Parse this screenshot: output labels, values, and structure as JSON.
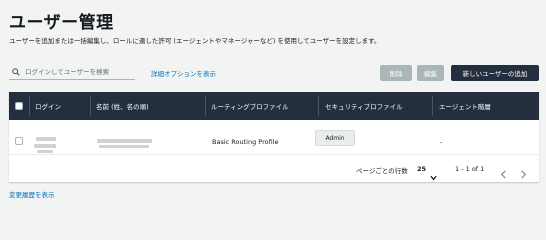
{
  "page": {
    "title": "ユーザー管理",
    "description": "ユーザーを追加または一括編集し、ロールに適した許可 (エージェントやマネージャーなど) を使用してユーザーを設定します。"
  },
  "toolbar": {
    "search_placeholder": "ログインしてユーザーを検索",
    "search_icon": "search-icon",
    "advanced_link": "詳細オプションを表示",
    "delete_label": "削除",
    "edit_label": "編集",
    "add_label": "新しいユーザーの追加"
  },
  "table": {
    "columns": [
      "ログイン",
      "名前 (姓、名の順)",
      "ルーティングプロファイル",
      "セキュリティプロファイル",
      "エージェント階層"
    ],
    "rows": [
      {
        "login": "",
        "name": "",
        "routing_profile": "Basic Routing Profile",
        "security_profile": "Admin",
        "hierarchy": "-"
      }
    ]
  },
  "pagination": {
    "rows_per_page_label": "ページごとの行数",
    "rows_per_page": "25",
    "range": "1 - 1 of 1"
  },
  "footer": {
    "history_link": "変更履歴を表示"
  },
  "colors": {
    "header_bg": "#232f3e",
    "link": "#0073bb",
    "disabled_button": "#aab7b8",
    "page_bg": "#f2f3f3"
  }
}
